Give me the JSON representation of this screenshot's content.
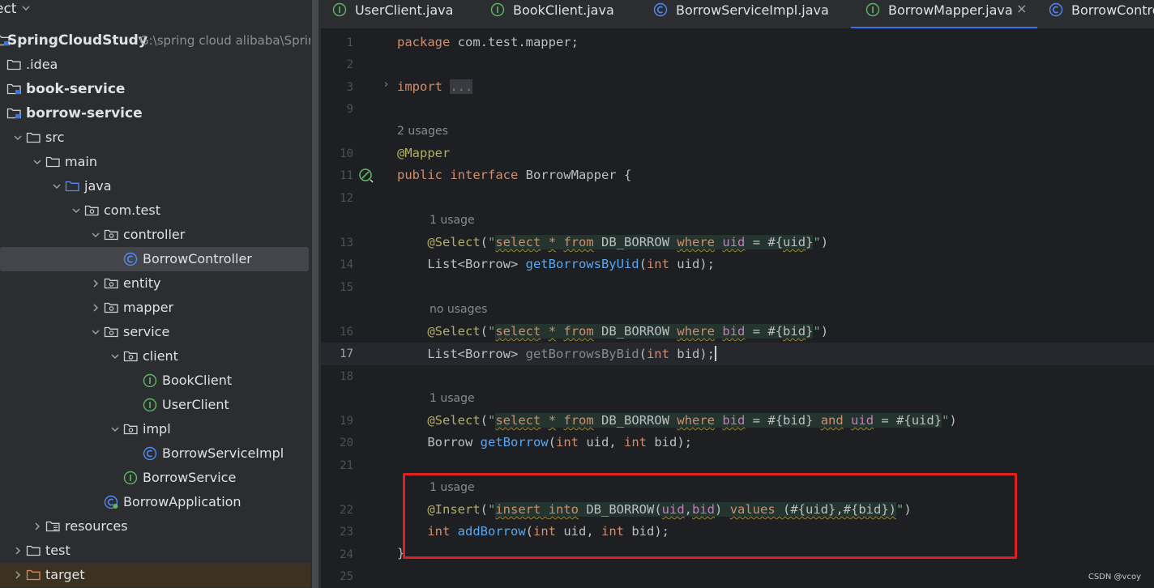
{
  "project": {
    "header": "ect",
    "root_name": "SpringCloudStudy",
    "root_path": "G:\\spring cloud alibaba\\Sprin",
    "tree": [
      {
        "label": "SpringCloudStudy",
        "depth": 0,
        "icon": "module-folder-icon",
        "arrow": "none",
        "bold": true
      },
      {
        "label": ".idea",
        "depth": 0,
        "icon": "folder-icon",
        "arrow": "none",
        "bold": false
      },
      {
        "label": "book-service",
        "depth": 0,
        "icon": "module-folder-icon",
        "arrow": "none",
        "bold": true
      },
      {
        "label": "borrow-service",
        "depth": 0,
        "icon": "module-folder-icon",
        "arrow": "none",
        "bold": true
      },
      {
        "label": "src",
        "depth": 1,
        "icon": "folder-icon",
        "arrow": "down",
        "bold": false
      },
      {
        "label": "main",
        "depth": 2,
        "icon": "folder-icon",
        "arrow": "down",
        "bold": false
      },
      {
        "label": "java",
        "depth": 3,
        "icon": "source-folder-icon",
        "arrow": "down",
        "bold": false
      },
      {
        "label": "com.test",
        "depth": 4,
        "icon": "package-icon",
        "arrow": "down",
        "bold": false
      },
      {
        "label": "controller",
        "depth": 5,
        "icon": "package-icon",
        "arrow": "down",
        "bold": false
      },
      {
        "label": "BorrowController",
        "depth": 6,
        "icon": "class-icon",
        "arrow": "none",
        "bold": false,
        "selected": true
      },
      {
        "label": "entity",
        "depth": 5,
        "icon": "package-icon",
        "arrow": "right",
        "bold": false
      },
      {
        "label": "mapper",
        "depth": 5,
        "icon": "package-icon",
        "arrow": "right",
        "bold": false
      },
      {
        "label": "service",
        "depth": 5,
        "icon": "package-icon",
        "arrow": "down",
        "bold": false
      },
      {
        "label": "client",
        "depth": 6,
        "icon": "package-icon",
        "arrow": "down",
        "bold": false
      },
      {
        "label": "BookClient",
        "depth": 7,
        "icon": "interface-icon",
        "arrow": "none",
        "bold": false
      },
      {
        "label": "UserClient",
        "depth": 7,
        "icon": "interface-icon",
        "arrow": "none",
        "bold": false
      },
      {
        "label": "impl",
        "depth": 6,
        "icon": "package-icon",
        "arrow": "down",
        "bold": false
      },
      {
        "label": "BorrowServiceImpl",
        "depth": 7,
        "icon": "class-icon",
        "arrow": "none",
        "bold": false
      },
      {
        "label": "BorrowService",
        "depth": 6,
        "icon": "interface-icon",
        "arrow": "none",
        "bold": false
      },
      {
        "label": "BorrowApplication",
        "depth": 5,
        "icon": "spring-class-icon",
        "arrow": "none",
        "bold": false
      },
      {
        "label": "resources",
        "depth": 2,
        "icon": "resources-folder-icon",
        "arrow": "right",
        "bold": false
      },
      {
        "label": "test",
        "depth": 1,
        "icon": "folder-icon",
        "arrow": "right",
        "bold": false
      },
      {
        "label": "target",
        "depth": 1,
        "icon": "excluded-folder-icon",
        "arrow": "right",
        "bold": false,
        "target": true
      }
    ]
  },
  "tabs": [
    {
      "label": "UserClient.java",
      "icon": "interface-icon",
      "active": false
    },
    {
      "label": "BookClient.java",
      "icon": "interface-icon",
      "active": false
    },
    {
      "label": "BorrowServiceImpl.java",
      "icon": "class-icon",
      "active": false
    },
    {
      "label": "BorrowMapper.java",
      "icon": "interface-icon",
      "active": true,
      "close": "×"
    },
    {
      "label": "BorrowContro",
      "icon": "class-icon",
      "active": false
    }
  ],
  "editor": {
    "line_numbers": [
      "1",
      "2",
      "3",
      "9",
      "",
      "10",
      "11",
      "12",
      "",
      "13",
      "14",
      "15",
      "",
      "16",
      "17",
      "18",
      "",
      "19",
      "20",
      "21",
      "",
      "22",
      "23",
      "24",
      "25"
    ],
    "current_line": "17",
    "hints": {
      "interface": "2 usages",
      "by_uid": "1 usage",
      "by_bid": "no usages",
      "get_borrow": "1 usage",
      "add_borrow": "1 usage"
    },
    "fold_placeholder": "..."
  },
  "watermark": "CSDN @vcoy",
  "colors": {
    "accent": "#3574f0",
    "highlight_box": "#e02020",
    "keyword": "#cf8e6d",
    "annotation": "#b3ae60",
    "method": "#56a8f5",
    "string": "#6aab73"
  }
}
